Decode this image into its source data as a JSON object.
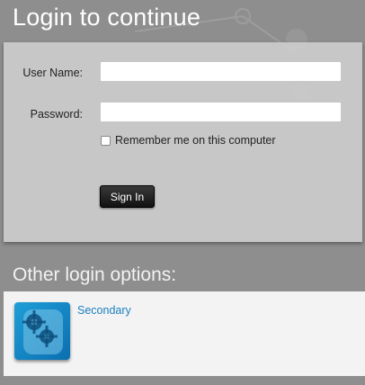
{
  "header": {
    "title": "Login to continue"
  },
  "login_form": {
    "username_label": "User Name:",
    "username_value": "",
    "password_label": "Password:",
    "password_value": "",
    "remember_label": "Remember me on this computer",
    "remember_checked": false,
    "sign_in_label": "Sign In"
  },
  "other_options": {
    "title": "Other login options:",
    "items": [
      {
        "label": "Secondary",
        "icon": "gears-icon"
      }
    ]
  },
  "colors": {
    "background": "#8e8e8e",
    "panel": "#d0d0d0",
    "link": "#1a7fc1",
    "button": "#1a1a1a",
    "icon_blue": "#1f9ed8"
  }
}
